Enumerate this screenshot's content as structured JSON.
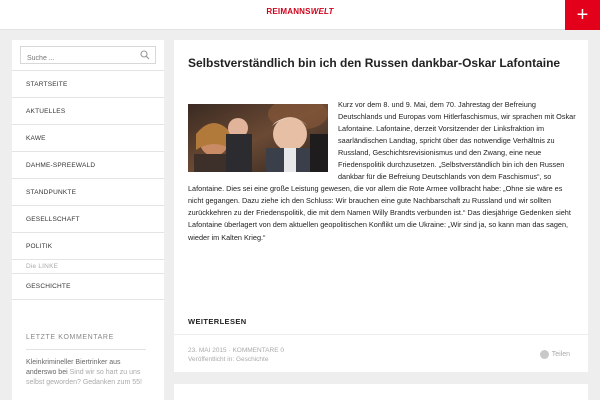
{
  "header": {
    "logo_part1": "REIMANNS",
    "logo_part2": "WELT",
    "add_button": "+"
  },
  "sidebar": {
    "search_placeholder": "Suche ...",
    "items": [
      {
        "label": "STARTSEITE"
      },
      {
        "label": "AKTUELLES"
      },
      {
        "label": "KAWE"
      },
      {
        "label": "DAHME-SPREEWALD"
      },
      {
        "label": "STANDPUNKTE"
      },
      {
        "label": "GESELLSCHAFT"
      },
      {
        "label": "POLITIK"
      },
      {
        "label": "Die LINKE"
      },
      {
        "label": "GESCHICHTE"
      }
    ],
    "widget_title": "LETZTE KOMMENTARE",
    "widget_author": "Kleinkrimineller Biertrinker aus anderswo bei",
    "widget_link": "Sind wir so hart zu uns selbst geworden? Gedanken zum 55!"
  },
  "article": {
    "title": "Selbstverständlich bin ich den Russen dankbar-Oskar Lafontaine",
    "body": "Kurz vor dem 8. und 9. Mai, dem 70. Jahrestag der Befreiung Deutschlands und Europas vom Hitlerfaschismus, wir sprachen mit Oskar Lafontaine. Lafontaine, derzeit Vorsitzender der Linksfraktion im saarländischen Landtag, spricht über das notwendige Verhältnis zu Russland, Geschichtsrevisionismus und den Zwang, eine neue Friedenspolitik durchzusetzen. „Selbstverständlich bin ich den Russen dankbar für die Befreiung Deutschlands von dem Faschismus“, so Lafontaine. Dies sei eine große Leistung gewesen, die vor allem die Rote Armee vollbracht habe: „Ohne sie wäre es nicht gegangen. Dazu ziehe ich den Schluss: Wir brauchen eine gute Nachbarschaft zu Russland und wir sollten zurückkehren zu der Friedenspolitik, die mit dem Namen Willy Brandts verbunden ist.“ Das diesjährige Gedenken sieht Lafontaine überlagert von dem aktuellen geopolitischen Konflikt um die Ukraine: „Wir sind ja, so kann man das sagen, wieder im Kalten Krieg.“",
    "read_more": "WEITERLESEN",
    "meta_date": "23. MAI 2015 · KOMMENTARE 0",
    "meta_prefix": "Veröffentlicht in:",
    "meta_category": "Geschichte",
    "share_label": "Teilen"
  }
}
